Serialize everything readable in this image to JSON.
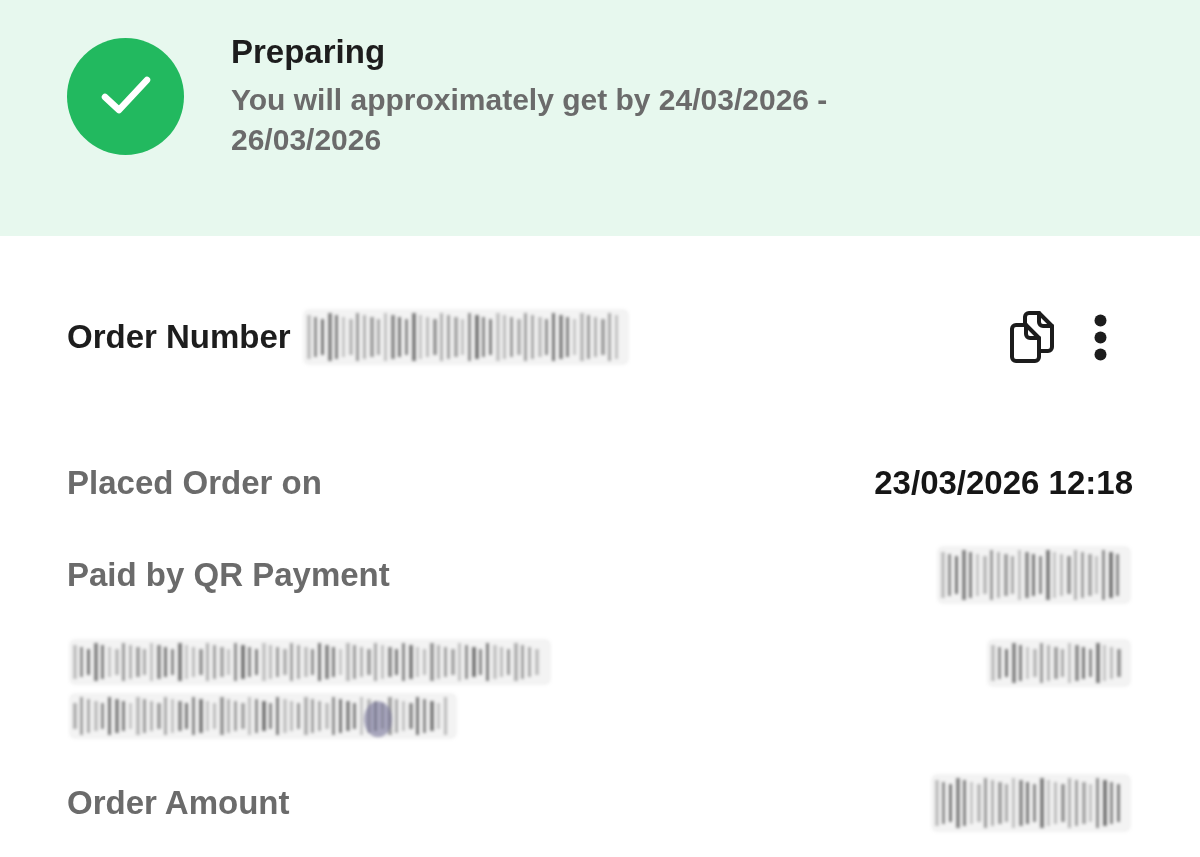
{
  "status": {
    "title": "Preparing",
    "message": "You will approximately get by 24/03/2026 - 26/03/2026"
  },
  "order": {
    "label": "Order Number",
    "value": {
      "kind": "blurred"
    }
  },
  "details": [
    {
      "label": {
        "kind": "text",
        "text": "Placed Order on"
      },
      "value": {
        "kind": "text",
        "text": "23/03/2026 12:18"
      }
    },
    {
      "label": {
        "kind": "text",
        "text": "Paid by QR Payment"
      },
      "value": {
        "kind": "blurred"
      }
    },
    {
      "label": {
        "kind": "blurred_paragraph"
      },
      "value": {
        "kind": "blurred"
      }
    },
    {
      "label": {
        "kind": "text",
        "text": "Order Amount"
      },
      "value": {
        "kind": "blurred"
      }
    }
  ]
}
